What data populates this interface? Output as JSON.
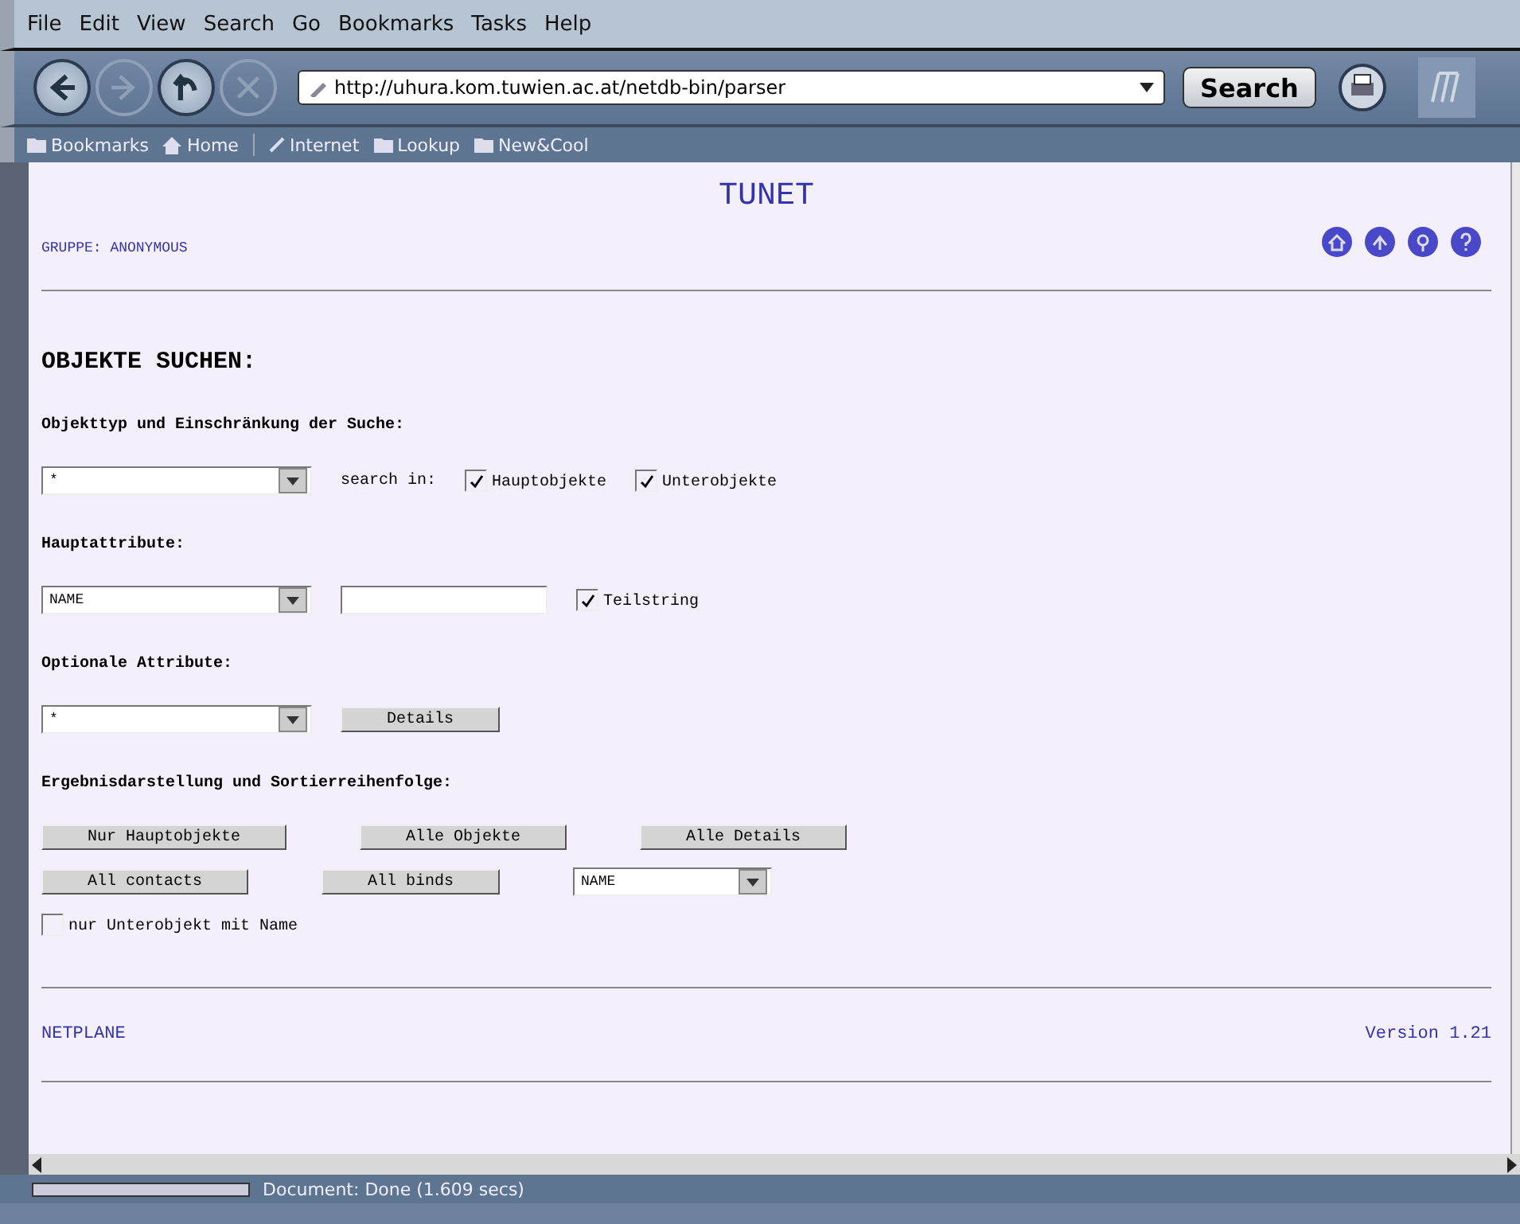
{
  "menu": [
    "File",
    "Edit",
    "View",
    "Search",
    "Go",
    "Bookmarks",
    "Tasks",
    "Help"
  ],
  "toolbar": {
    "nav": [
      {
        "kind": "back",
        "disabled": false
      },
      {
        "kind": "forward",
        "disabled": true
      },
      {
        "kind": "reload",
        "disabled": false
      },
      {
        "kind": "stop",
        "disabled": true
      }
    ],
    "url": "http://uhura.kom.tuwien.ac.at/netdb-bin/parser",
    "search_button": "Search"
  },
  "bookmarks": [
    {
      "kind": "folder",
      "label": "Bookmarks"
    },
    {
      "kind": "home",
      "label": "Home"
    },
    {
      "kind": "link",
      "label": "Internet"
    },
    {
      "kind": "folder",
      "label": "Lookup"
    },
    {
      "kind": "folder",
      "label": "New&Cool"
    }
  ],
  "page": {
    "title": "TUNET",
    "group": "GRUPPE: ANONYMOUS",
    "heading": "OBJEKTE SUCHEN:",
    "sections": [
      {
        "label": "Objekttyp und Einschränkung der Suche:",
        "controls": [
          {
            "kind": "select",
            "value": "*"
          },
          {
            "kind": "label",
            "text": "search in:"
          },
          {
            "kind": "checkbox",
            "label": "Hauptobjekte",
            "checked": true
          },
          {
            "kind": "checkbox",
            "label": "Unterobjekte",
            "checked": true
          }
        ]
      },
      {
        "label": "Hauptattribute:",
        "controls": [
          {
            "kind": "select",
            "value": "NAME"
          },
          {
            "kind": "input"
          },
          {
            "kind": "checkbox",
            "label": "Teilstring",
            "checked": true
          }
        ]
      },
      {
        "label": "Optionale Attribute:",
        "controls": [
          {
            "kind": "select",
            "value": "*"
          },
          {
            "kind": "button",
            "label": "Details"
          }
        ]
      },
      {
        "label": "Ergebnisdarstellung und Sortierreihenfolge:",
        "rows": [
          [
            {
              "kind": "button",
              "label": "Nur Hauptobjekte"
            },
            {
              "kind": "button",
              "label": "Alle Objekte"
            },
            {
              "kind": "button",
              "label": "Alle Details"
            }
          ],
          [
            {
              "kind": "button",
              "label": "All contacts"
            },
            {
              "kind": "button",
              "label": "All binds"
            },
            {
              "kind": "select",
              "value": "NAME"
            }
          ],
          [
            {
              "kind": "checkbox",
              "label": "nur Unterobjekt mit Name",
              "checked": false
            }
          ]
        ]
      }
    ],
    "footer_left": "NETPLANE",
    "footer_right": "Version 1.21"
  },
  "status": {
    "progress": {
      "level": 0
    },
    "text": "Document: Done (1.609 secs)"
  }
}
